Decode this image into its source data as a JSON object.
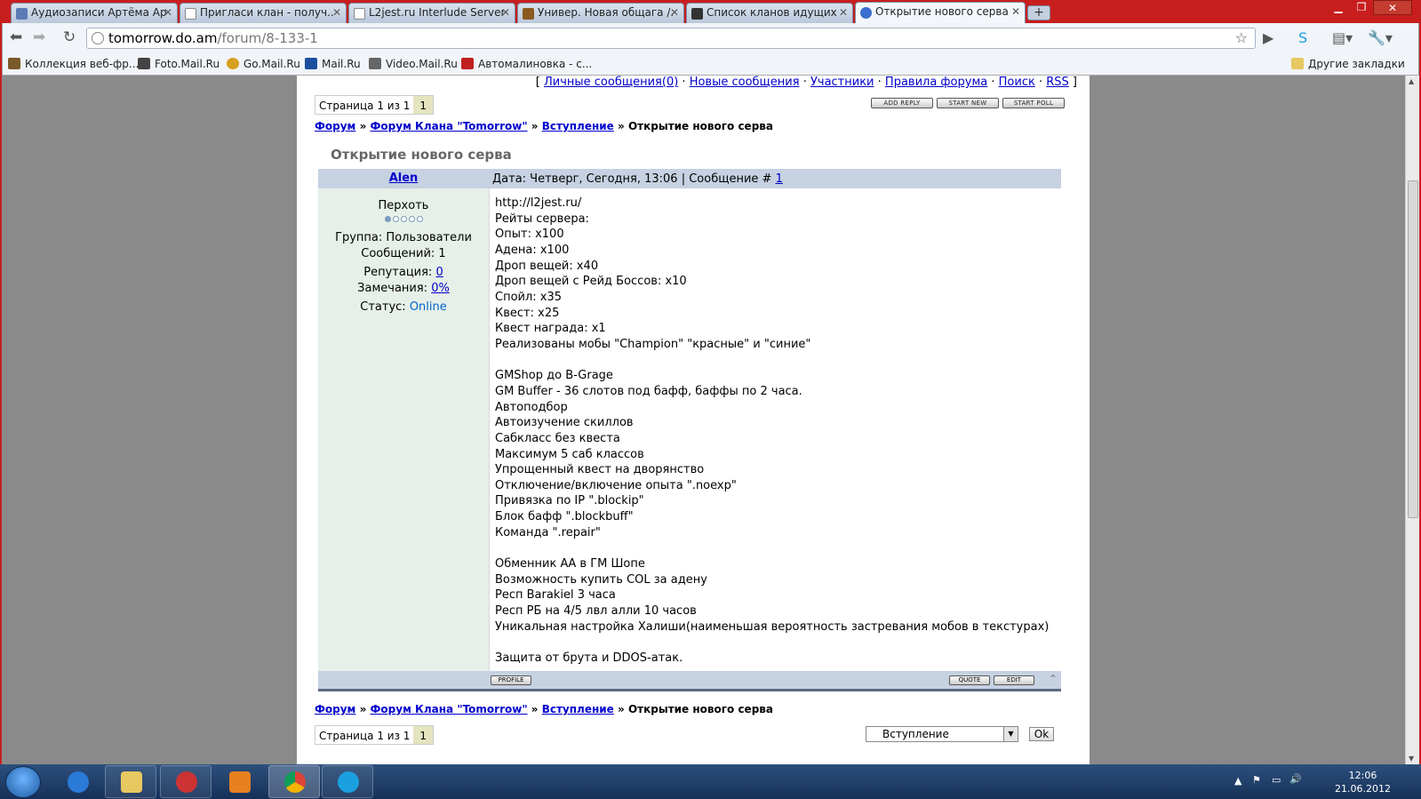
{
  "browser": {
    "tabs": [
      {
        "title": "Аудиозаписи Артёма Ар...",
        "color": "#5a7bb5"
      },
      {
        "title": "Пригласи клан - получ...",
        "color": "#ffffff"
      },
      {
        "title": "L2jest.ru Interlude Server ...",
        "color": "#ffffff"
      },
      {
        "title": "Универ. Новая общага /...",
        "color": "#8a5a20"
      },
      {
        "title": "Список кланов идущих ...",
        "color": "#333333"
      },
      {
        "title": "Открытие нового серва ...",
        "color": "#3a6ed0"
      }
    ],
    "url_host": "tomorrow.do.am",
    "url_path": "/forum/8-133-1",
    "bookmarks": [
      {
        "label": "Коллекция веб-фр...",
        "color": "#7a5a2a"
      },
      {
        "label": "Foto.Mail.Ru",
        "color": "#444444"
      },
      {
        "label": "Go.Mail.Ru",
        "color": "#d8a020"
      },
      {
        "label": "Mail.Ru",
        "color": "#1c4fa0"
      },
      {
        "label": "Video.Mail.Ru",
        "color": "#666666"
      },
      {
        "label": "Автомалиновка - с...",
        "color": "#c02020"
      }
    ],
    "other_bookmarks": "Другие закладки"
  },
  "forum": {
    "top_links": [
      "Личные сообщения(0)",
      "Новые сообщения",
      "Участники",
      "Правила форума",
      "Поиск",
      "RSS"
    ],
    "pager_text": "Страница 1 из 1",
    "pager_current": "1",
    "buttons": {
      "add_reply": "ADD REPLY",
      "start_new": "START NEW",
      "start_poll": "START POLL"
    },
    "breadcrumbs": [
      "Форум",
      "Форум Клана \"Tomorrow\"",
      "Вступление"
    ],
    "breadcrumb_current": "Открытие нового серва",
    "sep": "»",
    "thread_title": "Открытие нового серва",
    "post": {
      "author": "Alen",
      "meta_prefix": "Дата: Четверг, Сегодня, 13:06 | Сообщение #",
      "post_number": "1",
      "rank": "Перхоть",
      "group": "Группа: Пользователи",
      "messages": "Сообщений: 1",
      "reputation_label": "Репутация:",
      "reputation_value": "0",
      "warnings_label": "Замечания:",
      "warnings_value": "0%",
      "status_label": "Статус:",
      "status_value": "Online",
      "body": "http://l2jest.ru/\nРейты сервера:\nОпыт: x100\nАдена: x100\nДроп вещей: x40\nДроп вещей с Рейд Боссов: x10\nСпойл: x35\nКвест: x25\nКвест награда: x1\nРеализованы мобы \"Champion\" \"красные\" и \"синие\"\n\nGMShop до B-Grage\nGM Buffer - 36 слотов под бафф, баффы по 2 часа.\nАвтоподбор\nАвтоизучение скиллов\nСабкласс без квеста\nМаксимум 5 саб классов\nУпрощенный квест на дворянство\nОтключение/включение опыта \".noexp\"\nПривязка по IP \".blockip\"\nБлок бафф \".blockbuff\"\nКоманда \".repair\"\n\nОбменник АА в ГМ Шопе\nВозможность купить COL за адену\nРесп Barakiel 3 часа\nРесп РБ на 4/5 лвл алли 10 часов\nУникальная настройка Халиши(наименьшая вероятность застревания мобов в текстурах)\n\nЗащита от брута и DDOS-атак.",
      "profile_btn": "PROFILE",
      "quote_btn": "QUOTE",
      "edit_btn": "EDIT"
    },
    "jump_value": "Вступление",
    "ok_label": "Ok"
  },
  "taskbar": {
    "time": "12:06",
    "date": "21.06.2012",
    "apps": [
      {
        "name": "ie",
        "color": "#2a7ad8"
      },
      {
        "name": "explorer",
        "color": "#e8c860"
      },
      {
        "name": "app3",
        "color": "#cc3333"
      },
      {
        "name": "media",
        "color": "#e88020"
      },
      {
        "name": "chrome",
        "color": "#3a9a3a"
      },
      {
        "name": "skype",
        "color": "#1aa0e0"
      }
    ]
  }
}
